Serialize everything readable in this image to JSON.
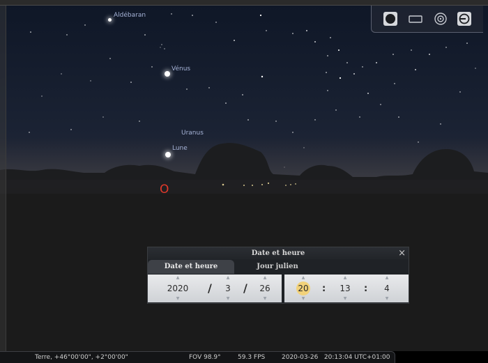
{
  "sky": {
    "labels": {
      "aldebaran": "Aldébaran",
      "venus": "Vénus",
      "uranus": "Uranus",
      "lune": "Lune"
    },
    "cardinal": "O"
  },
  "toolbar": {
    "icons": [
      "fullscreen-circle-icon",
      "window-icon",
      "target-icon",
      "planet-toggle-icon"
    ]
  },
  "dialog": {
    "title": "Date et heure",
    "close": "×",
    "tabs": [
      {
        "label": "Date et heure",
        "active": true
      },
      {
        "label": "Jour julien",
        "active": false
      }
    ],
    "date": {
      "year": "2020",
      "month": "3",
      "day": "26",
      "separator": "/"
    },
    "time": {
      "hour": "20",
      "minute": "13",
      "second": "4",
      "separator": ":"
    }
  },
  "status": {
    "location": "Terre, +46°00'00\", +2°00'00\"",
    "fov": "FOV 98.9°",
    "fps": "59.3 FPS",
    "datetime": "2020-03-26   20:13:04 UTC+01:00"
  },
  "colors": {
    "sky_top": "#0f1727",
    "horizon": "#33343b",
    "label": "#a7b4d8",
    "cardinal": "#e2392a",
    "highlight": "#f2d27a"
  }
}
